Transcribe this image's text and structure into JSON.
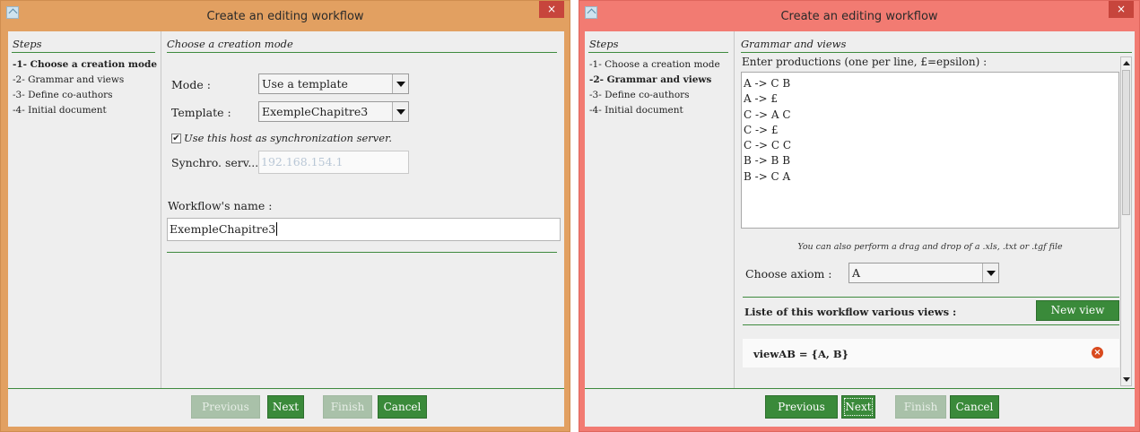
{
  "window1": {
    "title": "Create an editing workflow",
    "close_glyph": "×",
    "steps_header": "Steps",
    "steps": [
      {
        "label": "-1- Choose a creation mode"
      },
      {
        "label": "-2- Grammar and views"
      },
      {
        "label": "-3- Define co-authors"
      },
      {
        "label": "-4- Initial document"
      }
    ],
    "section_title": "Choose a creation mode",
    "mode_label": "Mode :",
    "mode_value": "Use a template",
    "template_label": "Template :",
    "template_value": "ExempleChapitre3",
    "sync_checkbox_label": "Use this host as synchronization server.",
    "sync_checked": true,
    "synchro_label": "Synchro. serv...",
    "synchro_value": "192.168.154.1",
    "workflow_name_label": "Workflow's name :",
    "workflow_name_value": "ExempleChapitre3",
    "buttons": {
      "previous": "Previous",
      "next": "Next",
      "finish": "Finish",
      "cancel": "Cancel"
    }
  },
  "window2": {
    "title": "Create an editing workflow",
    "close_glyph": "×",
    "steps_header": "Steps",
    "steps": [
      {
        "label": "-1- Choose a creation mode"
      },
      {
        "label": "-2- Grammar and views"
      },
      {
        "label": "-3- Define co-authors"
      },
      {
        "label": "-4- Initial document"
      }
    ],
    "section_title": "Grammar and views",
    "productions_label": "Enter productions (one per line, £=epsilon) :",
    "productions": [
      "A -> C B",
      "A -> £",
      "C -> A C",
      "C -> £",
      "C -> C C",
      "B -> B B",
      "B -> C A"
    ],
    "hint": "You can also perform a drag and drop of a .xls, .txt or .tgf file",
    "axiom_label": "Choose axiom :",
    "axiom_value": "A",
    "views_header": "Liste of this workflow various views :",
    "new_view_button": "New view",
    "views": [
      {
        "label": "viewAB = {A, B}"
      }
    ],
    "buttons": {
      "previous": "Previous",
      "next": "Next",
      "finish": "Finish",
      "cancel": "Cancel"
    }
  },
  "colors": {
    "window1_frame": "#e2a061",
    "window2_frame": "#f27b72",
    "accent_green": "#3a8a3a",
    "disabled_green": "#a9c1a9",
    "remove_red": "#d94a1e"
  }
}
